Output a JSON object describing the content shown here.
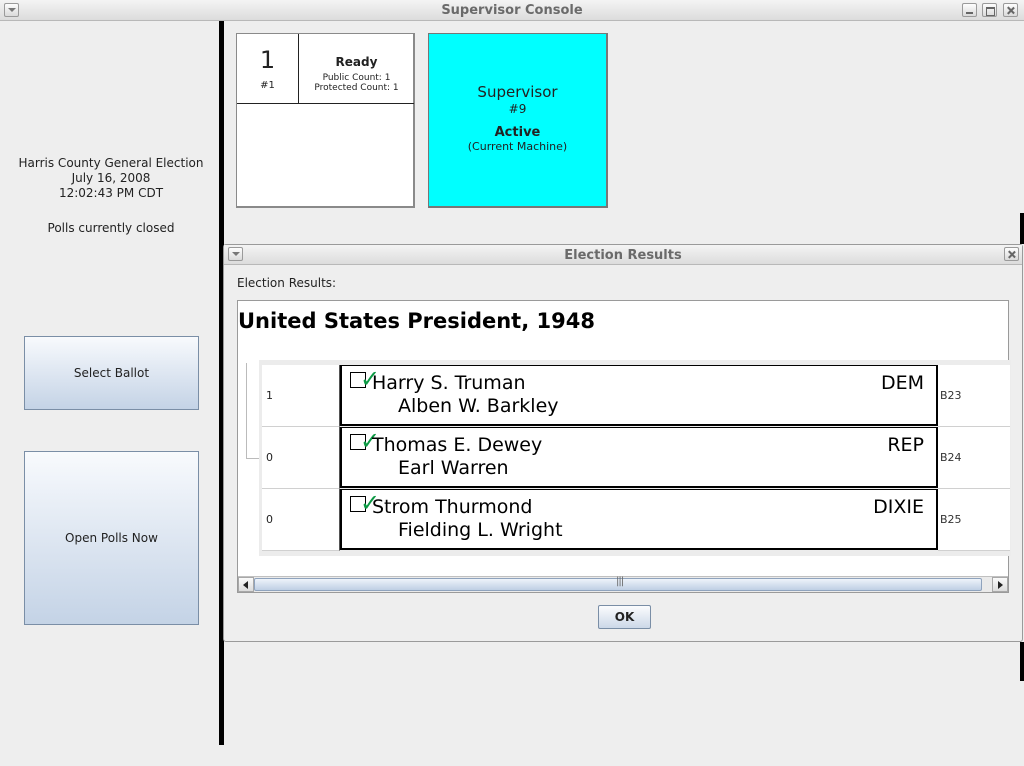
{
  "window": {
    "title": "Supervisor Console"
  },
  "sidebar": {
    "election_name": "Harris County General Election",
    "date": "July 16, 2008",
    "time": "12:02:43 PM CDT",
    "polls_status": "Polls currently closed",
    "select_ballot_label": "Select Ballot",
    "open_polls_label": "Open Polls Now"
  },
  "machines": [
    {
      "number": "1",
      "id": "#1",
      "status": "Ready",
      "public_count": "Public Count: 1",
      "protected_count": "Protected Count: 1"
    }
  ],
  "supervisor": {
    "label": "Supervisor",
    "id": "#9",
    "status": "Active",
    "note": "(Current Machine)",
    "color": "#00ffff"
  },
  "dialog": {
    "title": "Election Results",
    "heading": "Election Results:",
    "race": "United States President, 1948",
    "ok_label": "OK",
    "rows": [
      {
        "count": "1",
        "candidate": "Harry S. Truman",
        "running_mate": "Alben W. Barkley",
        "party": "DEM",
        "code": "B23"
      },
      {
        "count": "0",
        "candidate": "Thomas E. Dewey",
        "running_mate": "Earl Warren",
        "party": "REP",
        "code": "B24"
      },
      {
        "count": "0",
        "candidate": "Strom Thurmond",
        "running_mate": "Fielding L. Wright",
        "party": "DIXIE",
        "code": "B25"
      }
    ],
    "check_icon": "green-check-icon",
    "thumb_grip": "|||"
  }
}
